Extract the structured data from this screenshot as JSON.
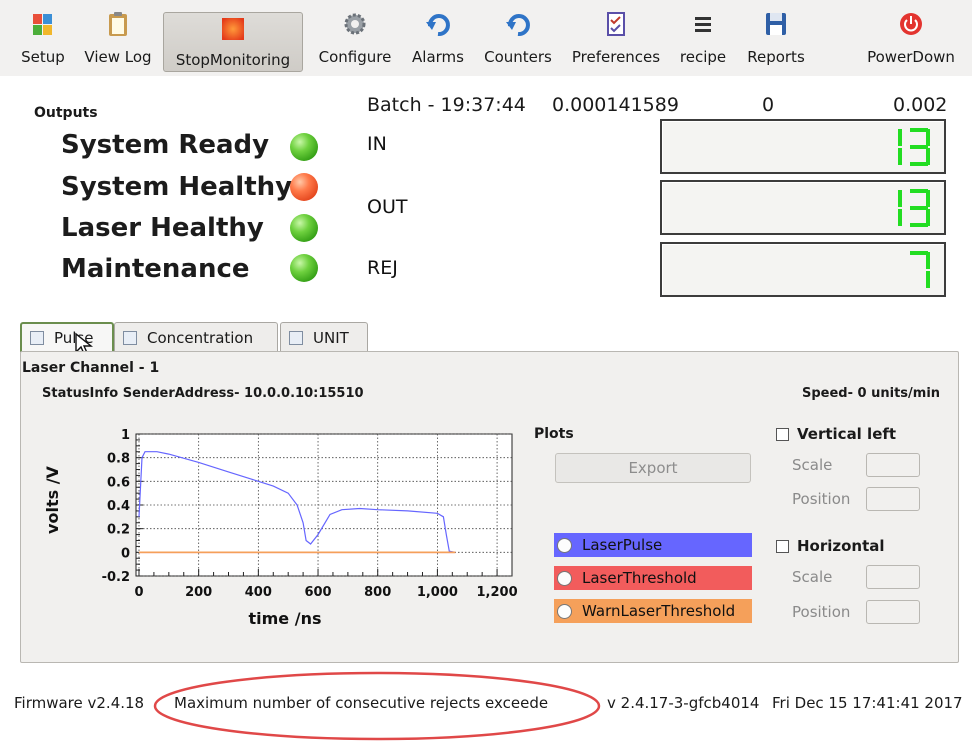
{
  "toolbar": {
    "buttons": [
      {
        "label": "Setup",
        "icon": "setup-icon"
      },
      {
        "label": "View Log",
        "icon": "clipboard-icon"
      },
      {
        "label": "StopMonitoring",
        "icon": "stop-icon"
      },
      {
        "label": "Configure",
        "icon": "gear-icon"
      },
      {
        "label": "Alarms",
        "icon": "undo-arrow-icon"
      },
      {
        "label": "Counters",
        "icon": "undo-arrow-icon"
      },
      {
        "label": "Preferences",
        "icon": "checklist-icon"
      },
      {
        "label": "recipe",
        "icon": "hamburger-menu-icon"
      },
      {
        "label": "Reports",
        "icon": "floppy-disk-icon"
      },
      {
        "label": "PowerDown",
        "icon": "power-icon"
      }
    ]
  },
  "outputs": {
    "title": "Outputs",
    "statuses": [
      {
        "label": "System Ready",
        "state": "green"
      },
      {
        "label": "System Healthy",
        "state": "red"
      },
      {
        "label": "Laser Healthy",
        "state": "green"
      },
      {
        "label": "Maintenance",
        "state": "green"
      }
    ]
  },
  "batch": {
    "label": "Batch - 19:37:44",
    "value1": "0.000141589",
    "value2": "0",
    "value3": "0.002"
  },
  "counters": [
    {
      "label": "IN",
      "value": "13"
    },
    {
      "label": "OUT",
      "value": "13"
    },
    {
      "label": "REJ",
      "value": "7"
    }
  ],
  "colors": {
    "digit": "#22dd22",
    "laser_pulse": "#6666ff",
    "laser_threshold": "#f25c5c",
    "warn_threshold": "#f5a05a"
  },
  "tabs": [
    {
      "label": "Pulse",
      "active": true
    },
    {
      "label": "Concentration",
      "active": false
    },
    {
      "label": "UNIT",
      "active": false
    }
  ],
  "panel": {
    "channel": "Laser Channel - 1",
    "status_info": "StatusInfo SenderAddress- 10.0.0.10:15510",
    "speed": "Speed- 0 units/min",
    "plots_label": "Plots",
    "export_label": "Export",
    "vertical": {
      "label": "Vertical left",
      "scale": "Scale",
      "position": "Position"
    },
    "horizontal": {
      "label": "Horizontal",
      "scale": "Scale",
      "position": "Position"
    },
    "legend": [
      "LaserPulse",
      "LaserThreshold",
      "WarnLaserThreshold"
    ]
  },
  "chart_data": {
    "type": "line",
    "xlabel": "time /ns",
    "ylabel": "volts /V",
    "xlim": [
      -10,
      1250
    ],
    "ylim": [
      -0.2,
      1.0
    ],
    "xticks": [
      "0",
      "200",
      "400",
      "600",
      "800",
      "1,000",
      "1,200"
    ],
    "yticks": [
      "-0.2",
      "0",
      "0.2",
      "0.4",
      "0.6",
      "0.8",
      "1"
    ],
    "grid": true,
    "series": [
      {
        "name": "LaserPulse",
        "x": [
          0,
          10,
          20,
          60,
          100,
          200,
          300,
          400,
          450,
          500,
          530,
          550,
          560,
          575,
          600,
          640,
          680,
          740,
          800,
          900,
          1000,
          1020,
          1030,
          1040,
          1060
        ],
        "y": [
          0.3,
          0.8,
          0.85,
          0.85,
          0.83,
          0.76,
          0.68,
          0.6,
          0.56,
          0.5,
          0.4,
          0.25,
          0.1,
          0.07,
          0.15,
          0.32,
          0.36,
          0.37,
          0.36,
          0.35,
          0.33,
          0.3,
          0.15,
          0.01,
          0.0
        ]
      },
      {
        "name": "LaserThreshold",
        "x": [
          0,
          1060
        ],
        "y": [
          0.0,
          0.0
        ]
      },
      {
        "name": "WarnLaserThreshold",
        "x": [
          0,
          1060
        ],
        "y": [
          0.0,
          0.0
        ]
      }
    ]
  },
  "statusbar": {
    "firmware": "Firmware v2.4.18",
    "message": "Maximum number of consecutive rejects exceede",
    "version": "v 2.4.17-3-gfcb4014",
    "datetime": "Fri Dec 15 17:41:41 2017"
  }
}
